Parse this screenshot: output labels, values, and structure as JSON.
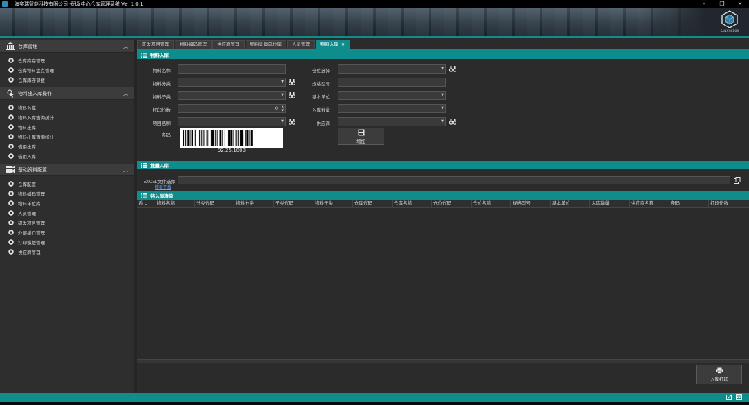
{
  "window": {
    "title": "上海奕瑞智能科技有限公司 -研发中心仓库管理系统 Ver 1.0.1",
    "logo_text": "SANXIN BOX"
  },
  "sidebar": {
    "groups": [
      {
        "label": "仓库管理",
        "items": [
          "仓库库存管理",
          "仓库物料盘点管理",
          "仓库库存调拨"
        ]
      },
      {
        "label": "物料出入库操作",
        "items": [
          "物料入库",
          "物料入库查询统计",
          "物料出库",
          "物料出库查询统计",
          "借用出库",
          "借用入库"
        ]
      },
      {
        "label": "基础资料配置",
        "items": [
          "仓库配置",
          "物料编码管理",
          "物料单位库",
          "人员管理",
          "研发项目管理",
          "外部接口管理",
          "打印模版管理",
          "供应商管理"
        ]
      }
    ]
  },
  "tabs": [
    "研发项目管理",
    "物料编码管理",
    "供应商管理",
    "物料计量单位库",
    "人员管理",
    "物料入库"
  ],
  "form": {
    "section_title": "物料入库",
    "left_labels": [
      "物料名称",
      "物料分类",
      "物料子类",
      "打印份数",
      "项目名称",
      "条码"
    ],
    "right_labels": [
      "仓位选择",
      "规格型号",
      "基本单位",
      "入库数量",
      "供应商"
    ],
    "print_count": "0",
    "barcode_value": "92.25.1003",
    "add_button": "增加"
  },
  "batch": {
    "section_title": "批量入库",
    "excel_label": "EXCEL文件选择",
    "template_link": "模板下载"
  },
  "list": {
    "section_title": "待入库清单",
    "columns": [
      "系...",
      "物料名称",
      "分类代码",
      "物料分类",
      "子类代码",
      "物料子类",
      "仓库代码",
      "仓库名称",
      "仓位代码",
      "仓位名称",
      "规格型号",
      "基本单位",
      "入库数量",
      "供应商名称",
      "条码",
      "打印份数"
    ]
  },
  "print_button": "入库打印",
  "colors": {
    "accent": "#0f8c8c",
    "background": "#2b2b2b",
    "sidebar": "#2e2e2e"
  }
}
